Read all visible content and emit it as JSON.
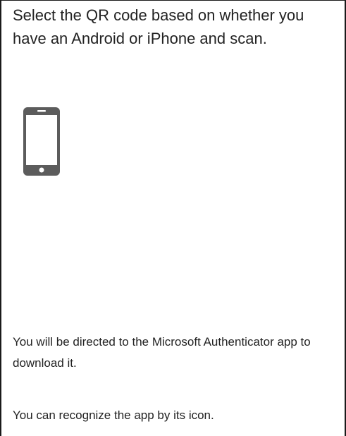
{
  "instructions": {
    "heading": "Select the QR code based on whether you have an Android or iPhone and scan.",
    "icon": "smartphone-icon",
    "note_direction": "You will be directed to the Microsoft Authenticator app to download it.",
    "note_recognize": "You can recognize the app by its icon."
  },
  "colors": {
    "text": "#222222",
    "icon": "#5c5c5c",
    "border": "#1a1a1a"
  }
}
